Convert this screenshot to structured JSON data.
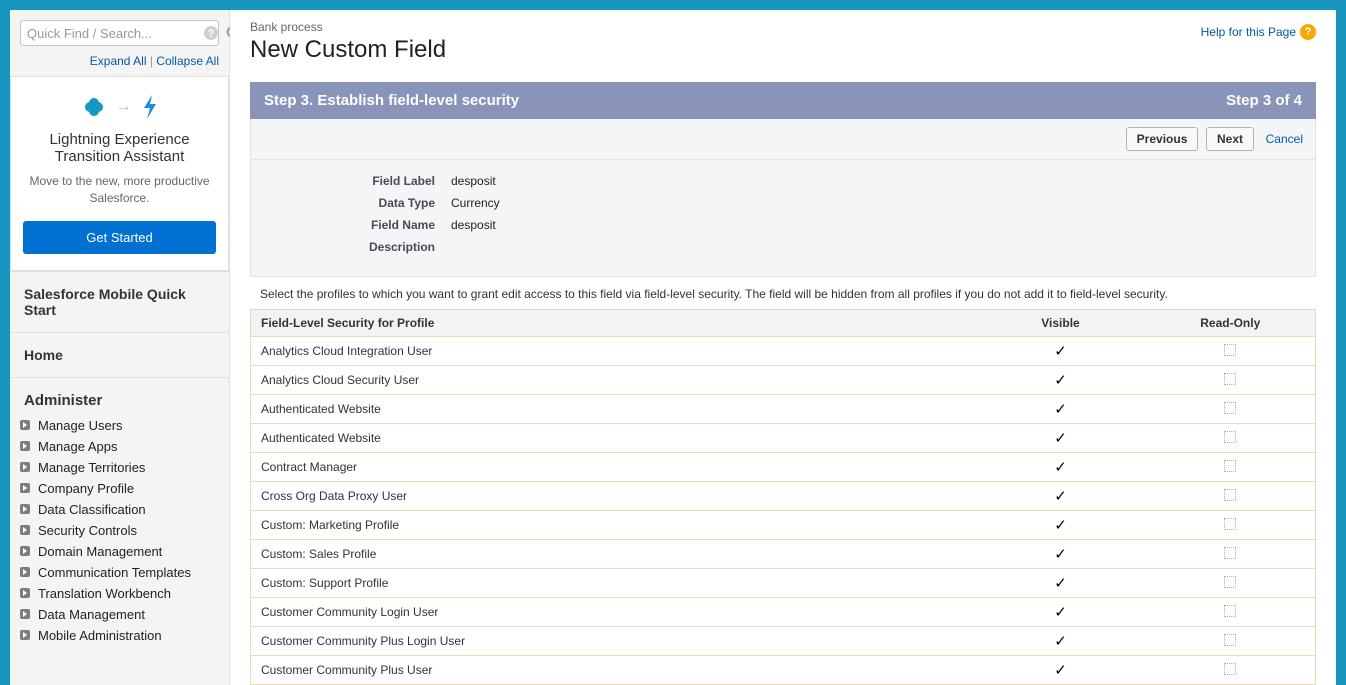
{
  "sidebar": {
    "search_placeholder": "Quick Find / Search...",
    "expand_all": "Expand All",
    "collapse_all": "Collapse All",
    "promo": {
      "title": "Lightning Experience Transition Assistant",
      "desc": "Move to the new, more productive Salesforce.",
      "button": "Get Started"
    },
    "quick_start": "Salesforce Mobile Quick Start",
    "home": "Home",
    "administer_label": "Administer",
    "administer_items": [
      "Manage Users",
      "Manage Apps",
      "Manage Territories",
      "Company Profile",
      "Data Classification",
      "Security Controls",
      "Domain Management",
      "Communication Templates",
      "Translation Workbench",
      "Data Management",
      "Mobile Administration"
    ]
  },
  "header": {
    "crumb": "Bank process",
    "title": "New Custom Field",
    "help": "Help for this Page"
  },
  "step": {
    "label": "Step 3. Establish field-level security",
    "progress": "Step 3 of 4",
    "previous": "Previous",
    "next": "Next",
    "cancel": "Cancel"
  },
  "field_info": {
    "label_label": "Field Label",
    "label_value": "desposit",
    "type_label": "Data Type",
    "type_value": "Currency",
    "name_label": "Field Name",
    "name_value": "desposit",
    "desc_label": "Description",
    "desc_value": ""
  },
  "instruction": "Select the profiles to which you want to grant edit access to this field via field-level security. The field will be hidden from all profiles if you do not add it to field-level security.",
  "table": {
    "col_profile": "Field-Level Security for Profile",
    "col_visible": "Visible",
    "col_readonly": "Read-Only",
    "rows": [
      {
        "name": "Analytics Cloud Integration User",
        "visible": true,
        "readonly": false
      },
      {
        "name": "Analytics Cloud Security User",
        "visible": true,
        "readonly": false
      },
      {
        "name": "Authenticated Website",
        "visible": true,
        "readonly": false
      },
      {
        "name": "Authenticated Website",
        "visible": true,
        "readonly": false
      },
      {
        "name": "Contract Manager",
        "visible": true,
        "readonly": false
      },
      {
        "name": "Cross Org Data Proxy User",
        "visible": true,
        "readonly": false
      },
      {
        "name": "Custom: Marketing Profile",
        "visible": true,
        "readonly": false
      },
      {
        "name": "Custom: Sales Profile",
        "visible": true,
        "readonly": false
      },
      {
        "name": "Custom: Support Profile",
        "visible": true,
        "readonly": false
      },
      {
        "name": "Customer Community Login User",
        "visible": true,
        "readonly": false
      },
      {
        "name": "Customer Community Plus Login User",
        "visible": true,
        "readonly": false
      },
      {
        "name": "Customer Community Plus User",
        "visible": true,
        "readonly": false
      }
    ]
  }
}
